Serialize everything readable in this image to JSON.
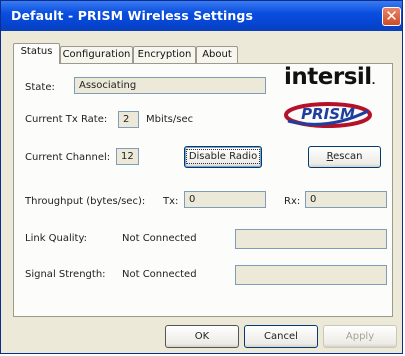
{
  "window": {
    "title": "Default - PRISM Wireless Settings",
    "close_glyph": "✕"
  },
  "tabs": [
    {
      "label": "Status",
      "active": true
    },
    {
      "label": "Configuration",
      "active": false
    },
    {
      "label": "Encryption",
      "active": false
    },
    {
      "label": "About",
      "active": false
    }
  ],
  "status": {
    "state_label": "State:",
    "state_value": "Associating",
    "tx_rate_label": "Current Tx Rate:",
    "tx_rate_value": "2",
    "tx_rate_unit": "Mbits/sec",
    "channel_label": "Current Channel:",
    "channel_value": "12",
    "disable_radio_button": "Disable Radio",
    "rescan_button_prefix": "R",
    "rescan_button_rest": "escan",
    "throughput_label": "Throughput (bytes/sec):",
    "tx_label": "Tx:",
    "tx_value": "0",
    "rx_label": "Rx:",
    "rx_value": "0",
    "link_quality_label": "Link Quality:",
    "link_quality_value": "Not Connected",
    "signal_strength_label": "Signal Strength:",
    "signal_strength_value": "Not Connected"
  },
  "logos": {
    "intersil": "intersil",
    "intersil_mark": ".",
    "prism": "PRISM"
  },
  "footer": {
    "ok": "OK",
    "cancel": "Cancel",
    "apply": "Apply"
  },
  "colors": {
    "titlebar": "#0a4ee0",
    "prism_red": "#b5122a",
    "prism_blue": "#1d3f9e"
  }
}
